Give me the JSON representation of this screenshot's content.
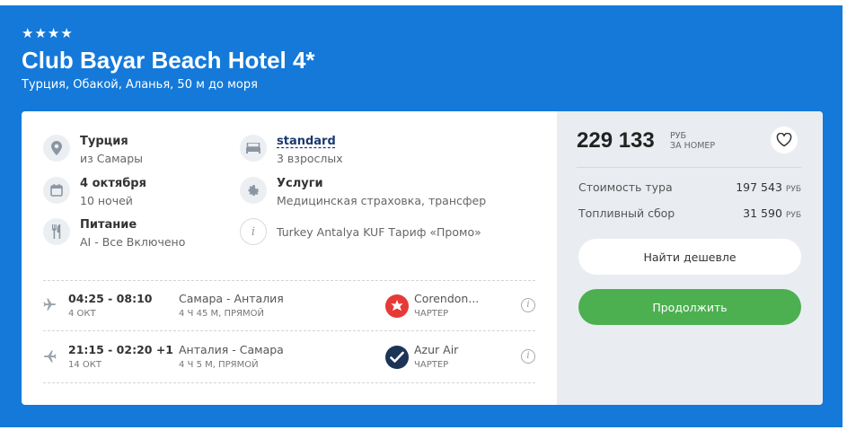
{
  "hotel": {
    "stars": "★★★★",
    "name": "Club Bayar Beach Hotel 4*",
    "location": "Турция, Обакой, Аланья, 50 м до моря"
  },
  "info": {
    "destination": {
      "title": "Турция",
      "sub": "из Самары",
      "icon": "location-pin-icon"
    },
    "room": {
      "title": "standard",
      "sub": "3 взрослых",
      "icon": "bed-icon"
    },
    "date": {
      "title": "4 октября",
      "sub": "10 ночей",
      "icon": "calendar-icon"
    },
    "services": {
      "title": "Услуги",
      "sub": "Медицинская страховка, трансфер",
      "icon": "gear-icon"
    },
    "meals": {
      "title": "Питание",
      "sub": "AI - Все Включено",
      "icon": "fork-knife-icon"
    },
    "tariff": {
      "text": "Turkey Antalya KUF Тариф «Промо»",
      "icon": "info-icon"
    }
  },
  "flights": [
    {
      "time": "04:25 - 08:10",
      "date": "4 ОКТ",
      "route": "Самара - Анталия",
      "duration": "4 Ч 45 М, ПРЯМОЙ",
      "airline": "Corendon...",
      "type": "ЧАРТЕР",
      "airline_color": "#e63a36"
    },
    {
      "time": "21:15 - 02:20 +1",
      "date": "14 ОКТ",
      "route": "Анталия - Самара",
      "duration": "4 Ч 5 М, ПРЯМОЙ",
      "airline": "Azur Air",
      "type": "ЧАРТЕР",
      "airline_color": "#1c3456"
    }
  ],
  "price": {
    "total": "229 133",
    "currency": "РУБ",
    "per": "ЗА НОМЕР",
    "tour_label": "Стоимость тура",
    "tour_value": "197 543",
    "fuel_label": "Топливный сбор",
    "fuel_value": "31 590",
    "value_currency": "РУБ"
  },
  "buttons": {
    "cheaper": "Найти дешевле",
    "continue": "Продолжить"
  },
  "colors": {
    "banner": "#1479d9",
    "accent_green": "#4cb050"
  }
}
